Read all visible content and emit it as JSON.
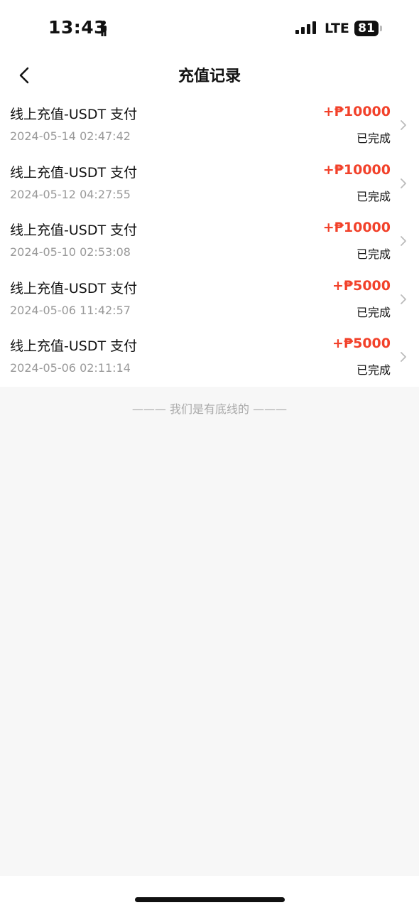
{
  "status_bar": {
    "time": "13:43",
    "network": "LTE",
    "battery": "81"
  },
  "header": {
    "title": "充值记录"
  },
  "records": [
    {
      "title": "线上充值-USDT 支付",
      "time": "2024-05-14 02:47:42",
      "amount": "+₱10000",
      "status": "已完成"
    },
    {
      "title": "线上充值-USDT 支付",
      "time": "2024-05-12 04:27:55",
      "amount": "+₱10000",
      "status": "已完成"
    },
    {
      "title": "线上充值-USDT 支付",
      "time": "2024-05-10 02:53:08",
      "amount": "+₱10000",
      "status": "已完成"
    },
    {
      "title": "线上充值-USDT 支付",
      "time": "2024-05-06 11:42:57",
      "amount": "+₱5000",
      "status": "已完成"
    },
    {
      "title": "线上充值-USDT 支付",
      "time": "2024-05-06 02:11:14",
      "amount": "+₱5000",
      "status": "已完成"
    }
  ],
  "footer": {
    "end_text": "——— 我们是有底线的 ———"
  },
  "colors": {
    "amount": "#f2412a",
    "background": "#f7f7f7"
  }
}
